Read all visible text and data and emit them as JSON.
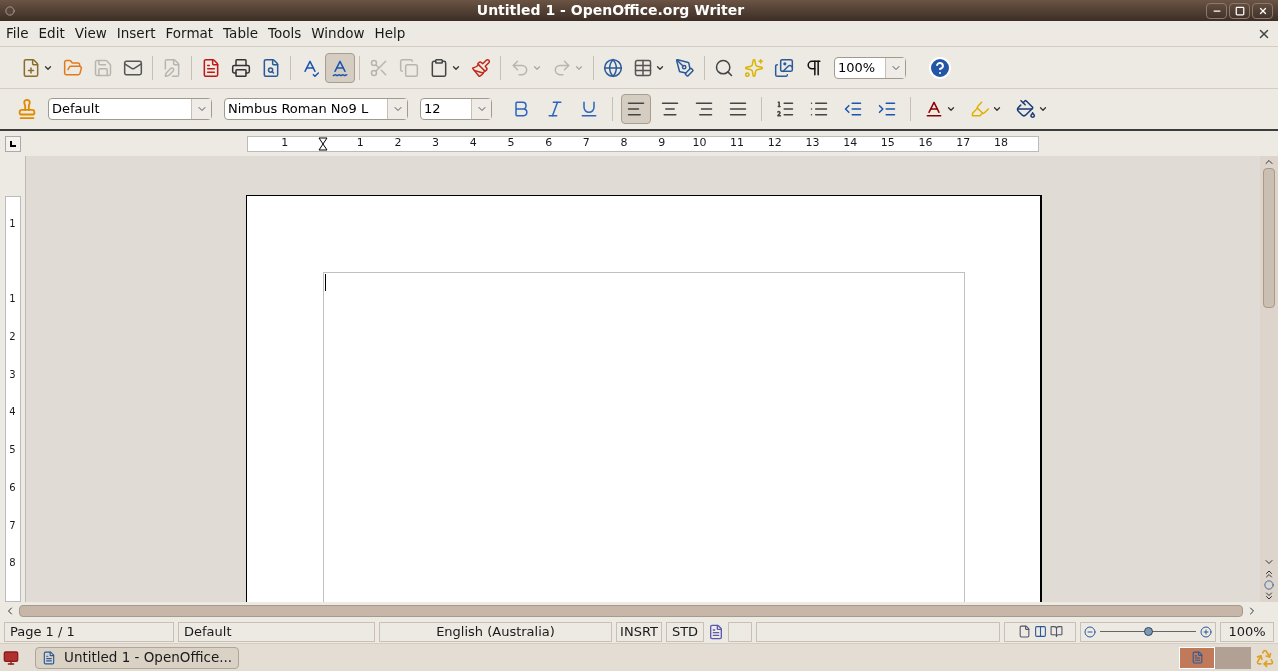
{
  "window": {
    "title": "Untitled 1 - OpenOffice.org Writer"
  },
  "menu": [
    {
      "label": "File"
    },
    {
      "label": "Edit"
    },
    {
      "label": "View"
    },
    {
      "label": "Insert"
    },
    {
      "label": "Format"
    },
    {
      "label": "Table"
    },
    {
      "label": "Tools"
    },
    {
      "label": "Window"
    },
    {
      "label": "Help"
    }
  ],
  "standard_toolbar": {
    "items": [
      {
        "kind": "new",
        "disabled": false,
        "pressed": false,
        "menu": true
      },
      {
        "kind": "open",
        "disabled": false,
        "pressed": false,
        "menu": false
      },
      {
        "kind": "save",
        "disabled": true,
        "pressed": false,
        "menu": false
      },
      {
        "kind": "mail",
        "disabled": false,
        "pressed": false,
        "menu": false
      },
      {
        "kind": "sep"
      },
      {
        "kind": "edit",
        "disabled": true,
        "pressed": false,
        "menu": false
      },
      {
        "kind": "sep"
      },
      {
        "kind": "pdf",
        "disabled": false,
        "pressed": false,
        "menu": false
      },
      {
        "kind": "print",
        "disabled": false,
        "pressed": false,
        "menu": false
      },
      {
        "kind": "preview",
        "disabled": false,
        "pressed": false,
        "menu": false
      },
      {
        "kind": "sep"
      },
      {
        "kind": "spelling",
        "disabled": false,
        "pressed": false,
        "menu": false
      },
      {
        "kind": "autospell",
        "disabled": false,
        "pressed": true,
        "menu": false
      },
      {
        "kind": "sep"
      },
      {
        "kind": "cut",
        "disabled": true,
        "pressed": false,
        "menu": false
      },
      {
        "kind": "copy",
        "disabled": true,
        "pressed": false,
        "menu": false
      },
      {
        "kind": "paste",
        "disabled": false,
        "pressed": false,
        "menu": true
      },
      {
        "kind": "brush",
        "disabled": false,
        "pressed": false,
        "menu": false
      },
      {
        "kind": "sep"
      },
      {
        "kind": "undo",
        "disabled": true,
        "pressed": false,
        "menu": true
      },
      {
        "kind": "redo",
        "disabled": true,
        "pressed": false,
        "menu": true
      },
      {
        "kind": "sep"
      },
      {
        "kind": "web",
        "disabled": false,
        "pressed": false,
        "menu": false
      },
      {
        "kind": "table",
        "disabled": false,
        "pressed": false,
        "menu": true
      },
      {
        "kind": "draw",
        "disabled": false,
        "pressed": false,
        "menu": false
      },
      {
        "kind": "sep"
      },
      {
        "kind": "find",
        "disabled": false,
        "pressed": false,
        "menu": false
      },
      {
        "kind": "navigator",
        "disabled": false,
        "pressed": false,
        "menu": false
      },
      {
        "kind": "gallery",
        "disabled": false,
        "pressed": false,
        "menu": false
      },
      {
        "kind": "marks",
        "disabled": false,
        "pressed": false,
        "menu": false
      }
    ],
    "zoom": "100%"
  },
  "formatting_toolbar": {
    "style": "Default",
    "font": "Nimbus Roman No9 L",
    "size": "12",
    "items": [
      {
        "kind": "bold",
        "disabled": false,
        "pressed": false,
        "menu": false
      },
      {
        "kind": "italic",
        "disabled": false,
        "pressed": false,
        "menu": false
      },
      {
        "kind": "underline",
        "disabled": false,
        "pressed": false,
        "menu": false
      },
      {
        "kind": "sep"
      },
      {
        "kind": "align-left",
        "disabled": false,
        "pressed": true,
        "menu": false
      },
      {
        "kind": "align-center",
        "disabled": false,
        "pressed": false,
        "menu": false
      },
      {
        "kind": "align-right",
        "disabled": false,
        "pressed": false,
        "menu": false
      },
      {
        "kind": "justify",
        "disabled": false,
        "pressed": false,
        "menu": false
      },
      {
        "kind": "sep"
      },
      {
        "kind": "numbering",
        "disabled": false,
        "pressed": false,
        "menu": false
      },
      {
        "kind": "bullets",
        "disabled": false,
        "pressed": false,
        "menu": false
      },
      {
        "kind": "outdent",
        "disabled": false,
        "pressed": false,
        "menu": false
      },
      {
        "kind": "indent",
        "disabled": false,
        "pressed": false,
        "menu": false
      },
      {
        "kind": "sep"
      },
      {
        "kind": "font-color",
        "disabled": false,
        "pressed": false,
        "menu": true
      },
      {
        "kind": "highlight",
        "disabled": false,
        "pressed": false,
        "menu": true
      },
      {
        "kind": "background",
        "disabled": false,
        "pressed": false,
        "menu": true
      }
    ]
  },
  "horizontal_ruler": {
    "left_numbers": [
      "1"
    ],
    "numbers": [
      "1",
      "2",
      "3",
      "4",
      "5",
      "6",
      "7",
      "8",
      "9",
      "10",
      "11",
      "12",
      "13",
      "14",
      "15",
      "16",
      "17",
      "18"
    ]
  },
  "vertical_ruler": {
    "top_numbers": [
      "1"
    ],
    "numbers": [
      "1",
      "2",
      "3",
      "4",
      "5",
      "6",
      "7",
      "8"
    ]
  },
  "status_bar": {
    "page": "Page 1 / 1",
    "page_style": "Default",
    "language": "English (Australia)",
    "insert_mode": "INSRT",
    "selection_mode": "STD",
    "level": 0.5,
    "zoom": "100%"
  },
  "taskbar": {
    "tasks": [
      {
        "label": "Untitled 1 - OpenOffice...",
        "selected": false
      }
    ],
    "workspaces": [
      {
        "selected": true
      },
      {
        "selected": false
      }
    ]
  }
}
